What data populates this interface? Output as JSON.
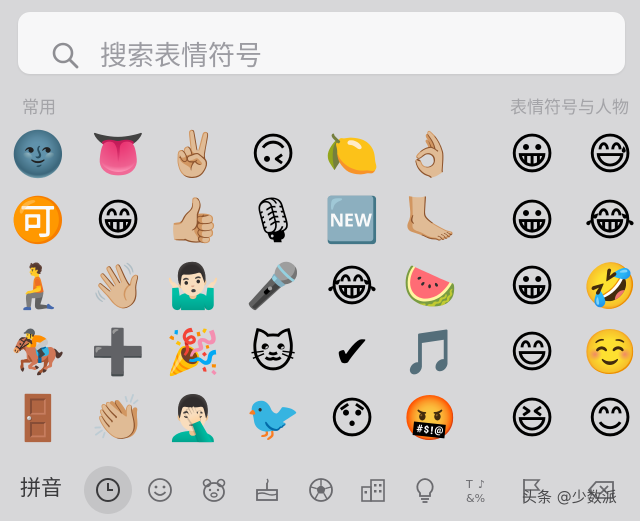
{
  "search": {
    "placeholder": "搜索表情符号"
  },
  "sections": {
    "frequent": "常用",
    "smileys": "表情符号与人物"
  },
  "emoji_rows": [
    [
      "🌚",
      "👅",
      "✌🏼",
      "🙃",
      "🍋",
      "👌🏼",
      "😀",
      "😅"
    ],
    [
      "🉑",
      "😁",
      "👍🏼",
      "🎙",
      "🆕",
      "🦶🏼",
      "😀",
      "😂"
    ],
    [
      "🧎",
      "👋🏼",
      "🤷🏻‍♂️",
      "🎤",
      "😂",
      "🍉",
      "😀",
      "🤣"
    ],
    [
      "🏇",
      "➕",
      "🎉",
      "🐱",
      "✔",
      "🎵",
      "😄",
      "☺️"
    ],
    [
      "🚪",
      "👏🏼",
      "🤦🏻‍♂️",
      "🐦",
      "😯",
      "🤬",
      "😆",
      "😊"
    ]
  ],
  "bottom": {
    "pinyin": "拼音",
    "categories": [
      "recent-clock",
      "smiley-face",
      "animal-bear",
      "food-cake",
      "sports-ball",
      "buildings",
      "lightbulb",
      "symbols",
      "flags",
      "delete"
    ],
    "watermark": "头条 @少数派"
  }
}
